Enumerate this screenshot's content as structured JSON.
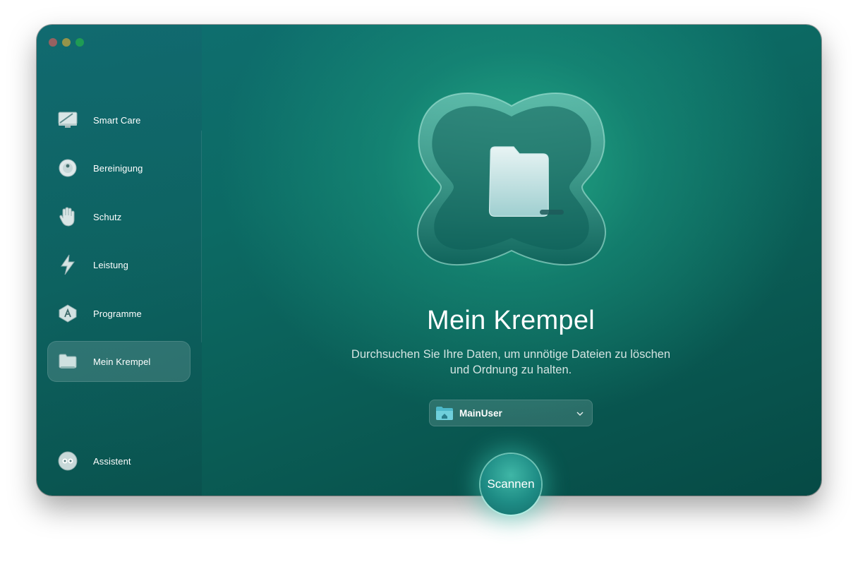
{
  "window": {
    "controls": {
      "close_color": "#ff5f57",
      "minimize_color": "#febc2e",
      "maximize_color": "#28c840"
    }
  },
  "sidebar": {
    "items": [
      {
        "label": "Smart Care",
        "icon": "monitor-icon",
        "active": false
      },
      {
        "label": "Bereinigung",
        "icon": "cleanup-disc-icon",
        "active": false
      },
      {
        "label": "Schutz",
        "icon": "hand-shield-icon",
        "active": false
      },
      {
        "label": "Leistung",
        "icon": "bolt-icon",
        "active": false
      },
      {
        "label": "Programme",
        "icon": "apps-icon",
        "active": false
      },
      {
        "label": "Mein Krempel",
        "icon": "folder-icon",
        "active": true
      }
    ],
    "assistant": {
      "label": "Assistent",
      "icon": "assistant-icon"
    }
  },
  "main": {
    "hero_icon": "folder-tray-icon",
    "title": "Mein Krempel",
    "subtitle_line1": "Durchsuchen Sie Ihre Daten, um unnötige Dateien zu löschen",
    "subtitle_line2": "und Ordnung zu halten.",
    "selector": {
      "value": "MainUser",
      "icon": "home-folder-icon"
    },
    "scan_button": "Scannen"
  },
  "colors": {
    "accent": "#1e8c85",
    "background": "#0b5f5a"
  }
}
